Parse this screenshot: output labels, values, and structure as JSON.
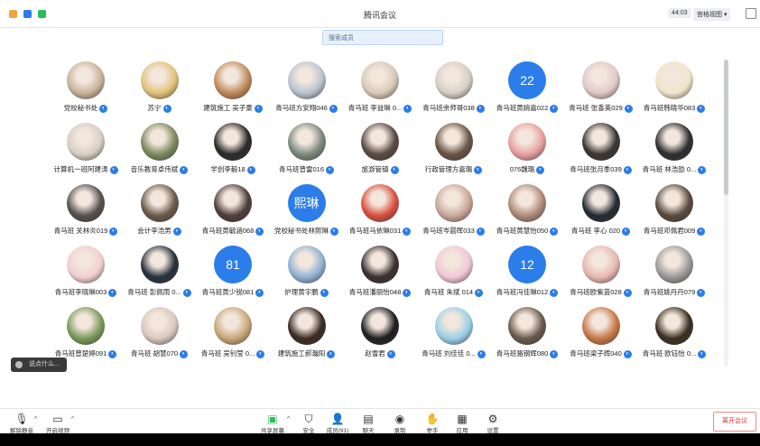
{
  "window": {
    "title": "腾讯会议",
    "timer": "44:03",
    "view_label": "宫格视图 ▾"
  },
  "search": {
    "placeholder": "搜索成员"
  },
  "colors": {
    "accent": "#2b7de9",
    "leave": "#e03535"
  },
  "participants": [
    {
      "name": "党校秘书处",
      "avatar": "photo",
      "color": "#c9b49a"
    },
    {
      "name": "苏宁",
      "avatar": "photo",
      "color": "#e2c37a"
    },
    {
      "name": "建筑施工 吴子豪",
      "avatar": "photo",
      "color": "#c08b5c"
    },
    {
      "name": "青马班方安翔046",
      "avatar": "photo",
      "color": "#b8c4cf"
    },
    {
      "name": "青马班 李益琳 0...",
      "avatar": "photo",
      "color": "#d9c8b8"
    },
    {
      "name": "青马班余师哥038",
      "avatar": "photo",
      "color": "#d6cfc8"
    },
    {
      "name": "青马班黄婉嘉022",
      "avatar": "number",
      "label": "22",
      "color": "#2b7de9"
    },
    {
      "name": "青马班 张香英029",
      "avatar": "photo",
      "color": "#e1c9c9"
    },
    {
      "name": "青马班韩晓华083",
      "avatar": "photo",
      "color": "#f0e6cc"
    },
    {
      "name": "计算机一班阿建涛",
      "avatar": "photo",
      "color": "#d8cfc4"
    },
    {
      "name": "音乐教育卓伟斌",
      "avatar": "photo",
      "color": "#7d8a5e"
    },
    {
      "name": "学创李毅18",
      "avatar": "photo",
      "color": "#2a2a2a"
    },
    {
      "name": "青马班曾雷016",
      "avatar": "photo",
      "color": "#7a8b80"
    },
    {
      "name": "旅游管镇",
      "avatar": "photo",
      "color": "#5a4a44"
    },
    {
      "name": "行政管理方嘉璐",
      "avatar": "photo",
      "color": "#6a5446"
    },
    {
      "name": "076魏璐",
      "avatar": "photo",
      "color": "#e8a0a0"
    },
    {
      "name": "青马班张月季039",
      "avatar": "photo",
      "color": "#3a3532"
    },
    {
      "name": "青马班 林浩劭 0...",
      "avatar": "photo",
      "color": "#2e2e2e"
    },
    {
      "name": "青马班 关林炎019",
      "avatar": "photo",
      "color": "#55514e"
    },
    {
      "name": "会计李浩男",
      "avatar": "photo",
      "color": "#6a5a4a"
    },
    {
      "name": "青马班黄毓涵068",
      "avatar": "photo",
      "color": "#4e3e3a"
    },
    {
      "name": "党校秘书处林熙琳",
      "avatar": "number",
      "label": "熙琳",
      "color": "#2b7de9"
    },
    {
      "name": "青马班马依琳031",
      "avatar": "photo",
      "color": "#d85040"
    },
    {
      "name": "青马班岑晨晖033",
      "avatar": "photo",
      "color": "#c9a89a"
    },
    {
      "name": "青马班黄慧怡050",
      "avatar": "photo",
      "color": "#b08a7a"
    },
    {
      "name": "青马班 李心 020",
      "avatar": "photo",
      "color": "#222a33"
    },
    {
      "name": "青马班邓佩君009",
      "avatar": "photo",
      "color": "#5a4a3e"
    },
    {
      "name": "青马班李晓琳003",
      "avatar": "photo",
      "color": "#f2d0d0"
    },
    {
      "name": "青马班 彭佩雨 0...",
      "avatar": "photo",
      "color": "#26313e"
    },
    {
      "name": "青马班黄少锐081",
      "avatar": "number",
      "label": "81",
      "color": "#2b7de9"
    },
    {
      "name": "护理黄宇鹏",
      "avatar": "photo",
      "color": "#8fb2d6"
    },
    {
      "name": "青马班潘丽怡048",
      "avatar": "photo",
      "color": "#3a3030"
    },
    {
      "name": "青马班 朱斌 014",
      "avatar": "photo",
      "color": "#f0c8d8"
    },
    {
      "name": "青马班冯佳琳012",
      "avatar": "number",
      "label": "12",
      "color": "#2b7de9"
    },
    {
      "name": "青马班欧紫蓝028",
      "avatar": "photo",
      "color": "#e8b8b0"
    },
    {
      "name": "青马班姚丹丹079",
      "avatar": "photo",
      "color": "#9a9a9a"
    },
    {
      "name": "青马班曾楚婷091",
      "avatar": "photo",
      "color": "#7a9a5a"
    },
    {
      "name": "青马班 胡慧070",
      "avatar": "photo",
      "color": "#d8c8c0"
    },
    {
      "name": "青马班 吴钊莹 0...",
      "avatar": "photo",
      "color": "#c8a87a"
    },
    {
      "name": "建筑施工郝瀚阳",
      "avatar": "photo",
      "color": "#3a2a22"
    },
    {
      "name": "赵雪君",
      "avatar": "photo",
      "color": "#1e1e1e"
    },
    {
      "name": "青马班 刘佳佳 0...",
      "avatar": "photo",
      "color": "#9ad0e8"
    },
    {
      "name": "青马班骆钢辉080",
      "avatar": "photo",
      "color": "#6a5a4e"
    },
    {
      "name": "青马班梁子辉040",
      "avatar": "photo",
      "color": "#c87848"
    },
    {
      "name": "青马班 欧钰怡 0...",
      "avatar": "photo",
      "color": "#3a3020"
    }
  ],
  "chat_popup": {
    "text": "说点什么..."
  },
  "toolbar": {
    "mute": "解除静音",
    "video": "开启视频",
    "share": "共享屏幕",
    "security": "安全",
    "members": "成员(91)",
    "chat": "聊天",
    "record": "录制",
    "raise_hand": "举手",
    "apps": "应用",
    "settings": "设置",
    "leave": "离开会议"
  }
}
